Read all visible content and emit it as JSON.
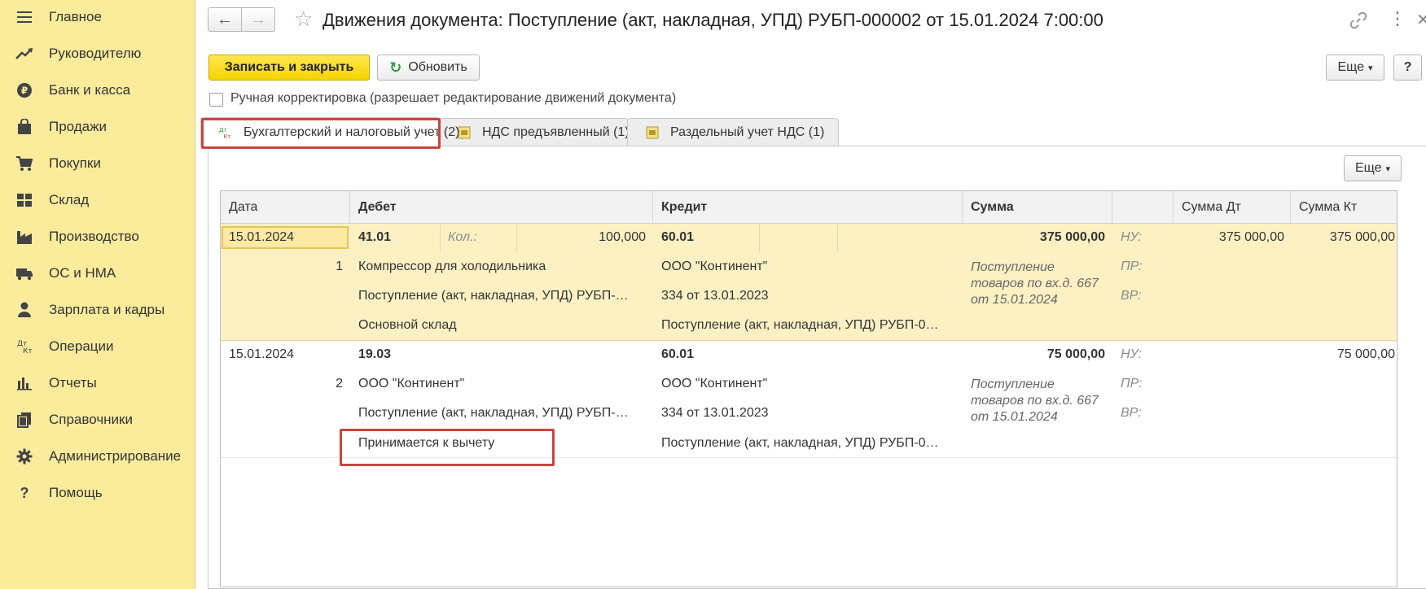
{
  "sidebar": {
    "items": [
      {
        "label": "Главное",
        "icon": "menu-icon"
      },
      {
        "label": "Руководителю",
        "icon": "trend-icon"
      },
      {
        "label": "Банк и касса",
        "icon": "ruble-coin-icon"
      },
      {
        "label": "Продажи",
        "icon": "shopping-bag-icon"
      },
      {
        "label": "Покупки",
        "icon": "cart-icon"
      },
      {
        "label": "Склад",
        "icon": "warehouse-icon"
      },
      {
        "label": "Производство",
        "icon": "factory-icon"
      },
      {
        "label": "ОС и НМА",
        "icon": "truck-icon"
      },
      {
        "label": "Зарплата и кадры",
        "icon": "person-icon"
      },
      {
        "label": "Операции",
        "icon": "dt-kt-icon",
        "icon_text_top": "Дт",
        "icon_text_bottom": "Кт"
      },
      {
        "label": "Отчеты",
        "icon": "bar-chart-icon"
      },
      {
        "label": "Справочники",
        "icon": "books-icon"
      },
      {
        "label": "Администрирование",
        "icon": "gear-icon"
      },
      {
        "label": "Помощь",
        "icon": "help-icon",
        "icon_text": "?"
      }
    ]
  },
  "header": {
    "back_glyph": "←",
    "forward_glyph": "→",
    "star_glyph": "☆",
    "title": "Движения документа: Поступление (акт, накладная, УПД) РУБП-000002 от 15.01.2024 7:00:00",
    "more_glyph": "⋮",
    "close_glyph": "✕"
  },
  "toolbar": {
    "save_close_label": "Записать и закрыть",
    "refresh_label": "Обновить",
    "refresh_glyph": "↻",
    "more_label": "Еще",
    "help_label": "?",
    "dropdown_glyph": "▾"
  },
  "manual_correction": {
    "label": "Ручная корректировка (разрешает редактирование движений документа)",
    "checked": false
  },
  "tabs": [
    {
      "label": "Бухгалтерский и налоговый учет (2)",
      "icon": "dt-kt-icon",
      "active": true
    },
    {
      "label": "НДС предъявленный (1)",
      "icon": "register-icon",
      "active": false
    },
    {
      "label": "Раздельный учет НДС (1)",
      "icon": "register-icon",
      "active": false
    }
  ],
  "panel": {
    "more_label": "Еще"
  },
  "table": {
    "columns": [
      "Дата",
      "Дебет",
      "Кредит",
      "Сумма",
      "",
      "Сумма Дт",
      "Сумма Кт"
    ],
    "rows": [
      {
        "date": "15.01.2024",
        "num": "1",
        "debit_account": "41.01",
        "qty_label": "Кол.:",
        "qty_value": "100,000",
        "debit_sub1": "Компрессор для холодильника",
        "debit_sub2": "Поступление (акт, накладная, УПД) РУБП-…",
        "debit_sub3": "Основной склад",
        "credit_account": "60.01",
        "credit_sub1": "ООО \"Континент\"",
        "credit_sub2": "334 от 13.01.2023",
        "credit_sub3": "Поступление (акт, накладная, УПД) РУБП-0…",
        "sum": "375 000,00",
        "content_line1": "Поступление",
        "content_line2": "товаров по вх.д. 667",
        "content_line3": "от 15.01.2024",
        "nu": "НУ:",
        "pr": "ПР:",
        "vr": "ВР:",
        "sum_dt": "375 000,00",
        "sum_kt": "375 000,00"
      },
      {
        "date": "15.01.2024",
        "num": "2",
        "debit_account": "19.03",
        "debit_sub1": "ООО \"Континент\"",
        "debit_sub2": "Поступление (акт, накладная, УПД) РУБП-…",
        "debit_sub3": "Принимается к вычету",
        "credit_account": "60.01",
        "credit_sub1": "ООО \"Континент\"",
        "credit_sub2": "334 от 13.01.2023",
        "credit_sub3": "Поступление (акт, накладная, УПД) РУБП-0…",
        "sum": "75 000,00",
        "content_line1": "Поступление",
        "content_line2": "товаров по вх.д. 667",
        "content_line3": "от 15.01.2024",
        "nu": "НУ:",
        "pr": "ПР:",
        "vr": "ВР:",
        "sum_dt": "",
        "sum_kt": "75 000,00"
      }
    ]
  },
  "colors": {
    "sidebar_bg": "#fbec9c",
    "selected_row_bg": "#fdf1c4",
    "primary_button": "#f5d400",
    "highlight_border": "#c9453f",
    "refresh_icon": "#2e9a3c"
  }
}
